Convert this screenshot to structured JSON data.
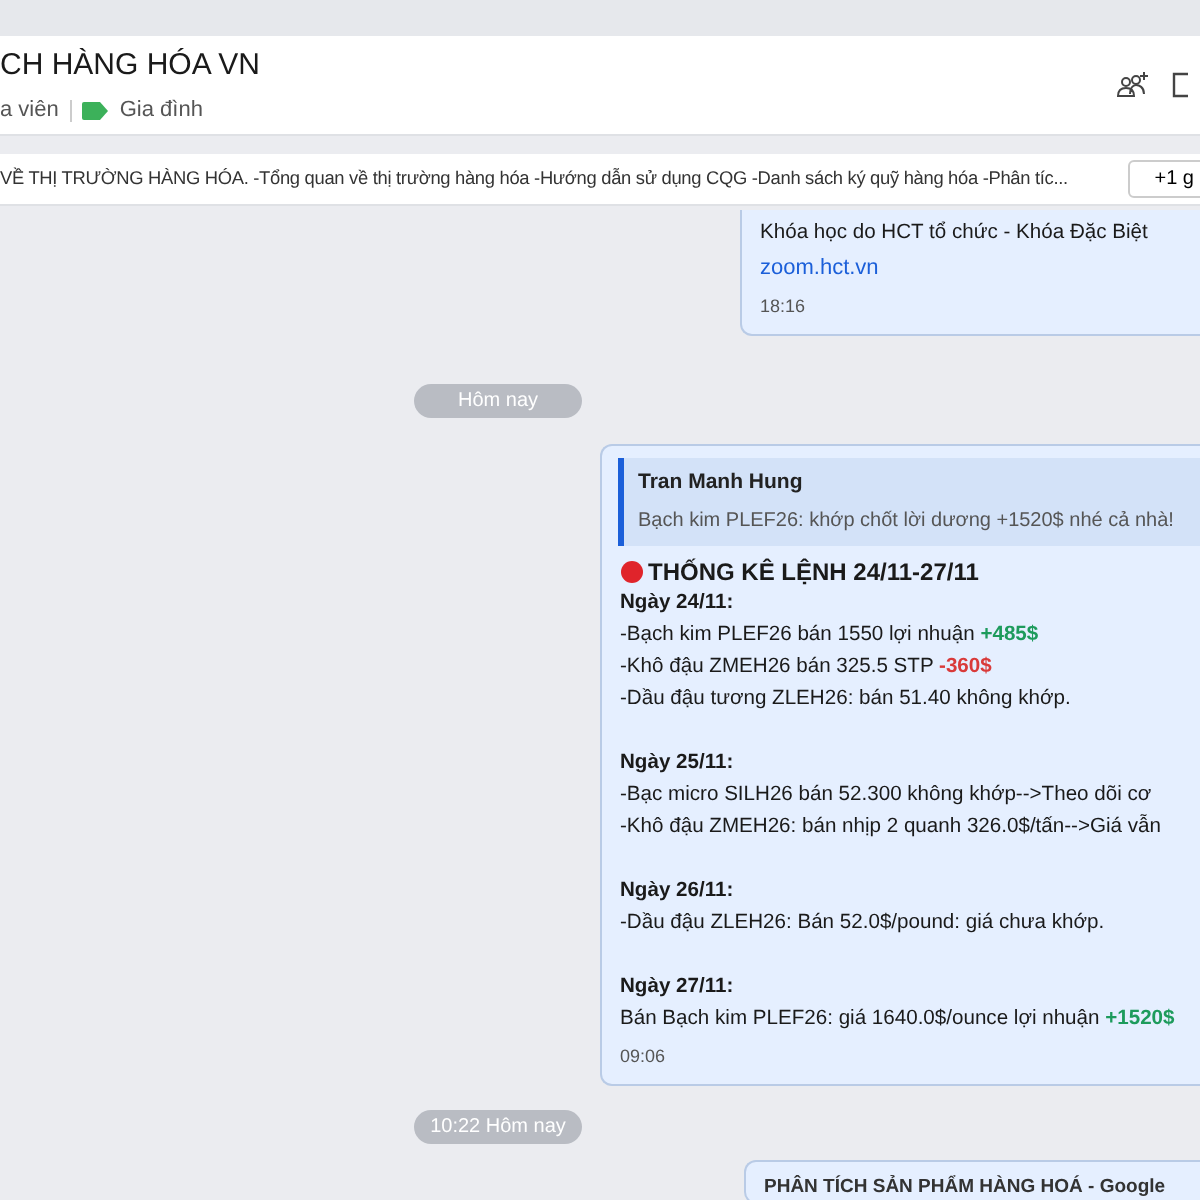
{
  "header": {
    "title": "CH HÀNG HÓA VN",
    "members": "a viên",
    "tag": {
      "label": "Gia đình",
      "color": "#3cb15a"
    }
  },
  "pinned": {
    "text": "VỀ THỊ TRƯỜNG HÀNG HÓA. -Tổng quan về thị trường hàng hóa -Hướng dẫn sử dụng CQG -Danh sách ký quỹ hàng hóa -Phân tíc...",
    "more": "+1 g"
  },
  "messages": [
    {
      "kind": "bubble",
      "lines": [
        {
          "kind": "item",
          "parts": [
            {
              "text": "Khóa học do HCT tổ chức - Khóa Đặc Biệt"
            }
          ]
        }
      ],
      "link": "zoom.hct.vn",
      "time": "18:16"
    },
    {
      "kind": "date",
      "text": "Hôm nay"
    },
    {
      "kind": "bubble",
      "quote": {
        "author": "Tran Manh Hung",
        "text": "Bạch kim PLEF26: khớp chốt lời dương +1520$ nhé cả nhà!"
      },
      "title": "THỐNG KÊ LỆNH 24/11-27/11",
      "lines": [
        {
          "kind": "heading",
          "parts": [
            {
              "text": "Ngày 24/11:"
            }
          ]
        },
        {
          "kind": "item",
          "parts": [
            {
              "text": "-Bạch kim PLEF26 bán 1550 lợi nhuận "
            },
            {
              "text": "+485$",
              "color": "#1d9b5c"
            }
          ]
        },
        {
          "kind": "item",
          "parts": [
            {
              "text": "-Khô đậu ZMEH26 bán 325.5  STP "
            },
            {
              "text": "-360$",
              "color": "#d93a3a"
            }
          ]
        },
        {
          "kind": "item",
          "parts": [
            {
              "text": "-Dầu đậu tương ZLEH26: bán 51.40 không khớp."
            }
          ]
        },
        {
          "kind": "heading",
          "parts": [
            {
              "text": "Ngày 25/11:"
            }
          ]
        },
        {
          "kind": "item",
          "parts": [
            {
              "text": "-Bạc micro SILH26 bán 52.300 không khớp-->Theo dõi cơ"
            }
          ]
        },
        {
          "kind": "item",
          "parts": [
            {
              "text": "-Khô đậu ZMEH26: bán nhịp 2 quanh 326.0$/tấn-->Giá vẫn"
            }
          ]
        },
        {
          "kind": "heading",
          "parts": [
            {
              "text": "Ngày 26/11:"
            }
          ]
        },
        {
          "kind": "item",
          "parts": [
            {
              "text": "-Dầu đậu ZLEH26: Bán 52.0$/pound: giá chưa khớp."
            }
          ]
        },
        {
          "kind": "heading",
          "parts": [
            {
              "text": "Ngày 27/11:"
            }
          ]
        },
        {
          "kind": "item",
          "parts": [
            {
              "text": "Bán Bạch kim PLEF26: giá 1640.0$/ounce lợi nhuận "
            },
            {
              "text": "+1520$",
              "color": "#1d9b5c"
            }
          ]
        }
      ],
      "time": "09:06"
    },
    {
      "kind": "date",
      "text": "10:22 Hôm nay"
    },
    {
      "kind": "bubble",
      "title_plain": "PHÂN TÍCH SẢN PHẨM HÀNG HOÁ - Google"
    }
  ]
}
